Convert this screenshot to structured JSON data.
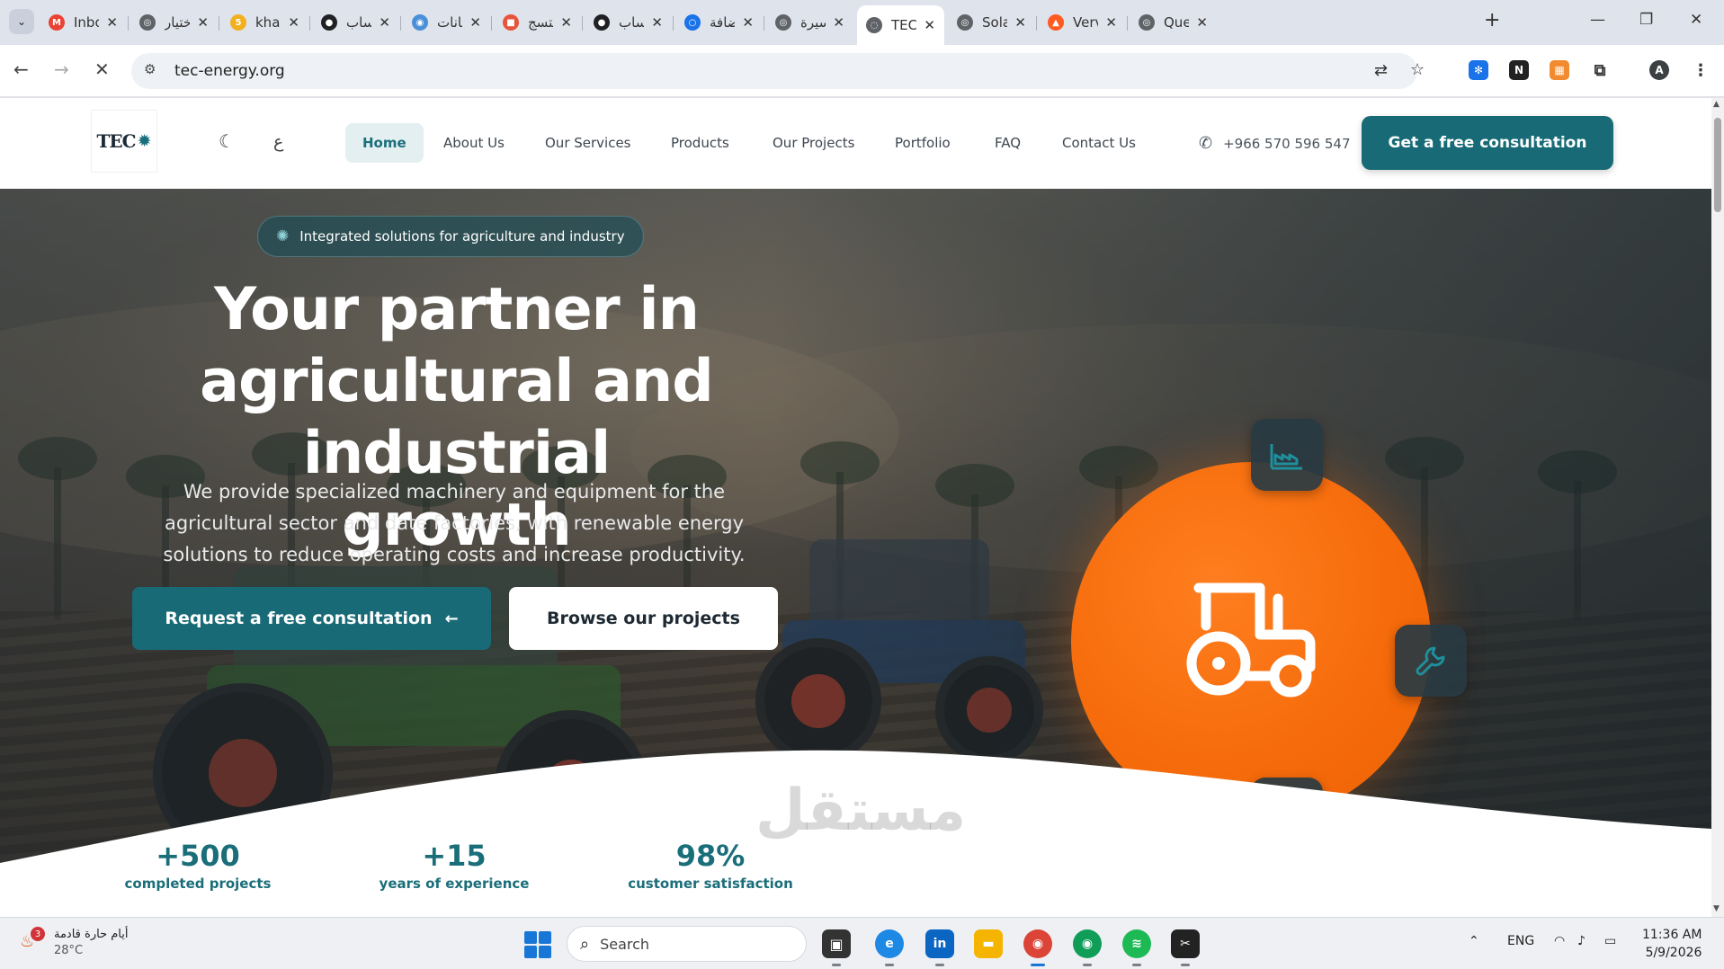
{
  "browser": {
    "tabs": [
      {
        "title": "Inbox",
        "fav_color": "#ea4335",
        "fav_glyph": "M"
      },
      {
        "title": "اختيار",
        "fav_color": "#5f6368",
        "fav_glyph": "◎"
      },
      {
        "title": "kham",
        "fav_color": "#f2b01e",
        "fav_glyph": "5"
      },
      {
        "title": "حساب",
        "fav_color": "#202124",
        "fav_glyph": "●"
      },
      {
        "title": "بيانات",
        "fav_color": "#4a90d9",
        "fav_glyph": "◉"
      },
      {
        "title": "التسج",
        "fav_color": "#e8543a",
        "fav_glyph": "■"
      },
      {
        "title": "حساب",
        "fav_color": "#202124",
        "fav_glyph": "●"
      },
      {
        "title": "إضافة",
        "fav_color": "#1a73e8",
        "fav_glyph": "○"
      },
      {
        "title": "سيرة",
        "fav_color": "#5f6368",
        "fav_glyph": "◎"
      },
      {
        "title": "TEC E",
        "fav_color": "#5f6368",
        "fav_glyph": "◌"
      },
      {
        "title": "Solar",
        "fav_color": "#5f6368",
        "fav_glyph": "◎"
      },
      {
        "title": "Verve",
        "fav_color": "#ff5a1f",
        "fav_glyph": "▲"
      },
      {
        "title": "Queu",
        "fav_color": "#5f6368",
        "fav_glyph": "◎"
      }
    ],
    "active_tab_index": 9,
    "url": "tec-energy.org"
  },
  "site": {
    "logo_text": "TEC",
    "dark_mode_icon": "moon-icon",
    "lang_toggle": "ع",
    "nav": [
      {
        "label": "Home",
        "active": true
      },
      {
        "label": "About Us",
        "active": false
      },
      {
        "label": "Our Services",
        "active": false
      },
      {
        "label": "Products",
        "active": false
      },
      {
        "label": "Our Projects",
        "active": false
      },
      {
        "label": "Portfolio",
        "active": false
      },
      {
        "label": "FAQ",
        "active": false
      },
      {
        "label": "Contact Us",
        "active": false
      }
    ],
    "phone": "+966 570 596 547",
    "cta_top": "Get a free consultation",
    "accent_color": "#186b76",
    "orange_color": "#f56a0a"
  },
  "hero": {
    "pill": "Integrated solutions for agriculture and industry",
    "title_line1": "Your partner in",
    "title_line2": "agricultural and industrial",
    "title_line3": "growth",
    "description": "We provide specialized machinery and equipment for the agricultural sector and date factories, with renewable energy solutions to reduce operating costs and increase productivity.",
    "btn_primary": "Request a free consultation",
    "btn_primary_arrow": "←",
    "btn_secondary": "Browse our projects"
  },
  "stats": [
    {
      "value": "+500",
      "label": "completed projects"
    },
    {
      "value": "+15",
      "label": "years of experience"
    },
    {
      "value": "98%",
      "label": "customer satisfaction"
    }
  ],
  "watermark": "مستقل",
  "taskbar": {
    "weather_text": "أيام حارة قادمة",
    "weather_temp": "28°C",
    "weather_badge": "3",
    "search_placeholder": "Search",
    "language": "ENG",
    "time": "11:36 AM",
    "date": "5/9/2026"
  }
}
